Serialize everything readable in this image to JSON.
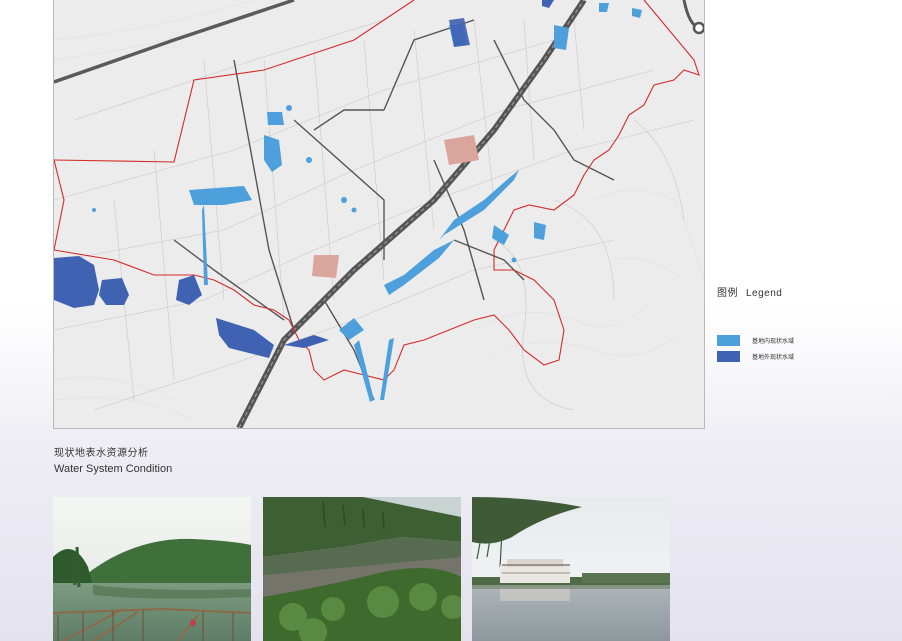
{
  "legend": {
    "title_cn": "图例",
    "title_en": "Legend",
    "items": [
      {
        "label": "基地内现状水域",
        "color": "#4ea0dc"
      },
      {
        "label": "基地外现状水域",
        "color": "#3f62b3"
      }
    ]
  },
  "caption": {
    "cn": "现状地表水资源分析",
    "en": "Water System Condition"
  },
  "colors": {
    "boundary": "#d42a2a",
    "road": "#4d4d4d",
    "water_inside": "#4ea0dc",
    "water_outside": "#3f62b3",
    "settlement": "#d9a59c",
    "map_bg": "#ececec"
  },
  "photos": [
    {
      "name": "lake-with-dock"
    },
    {
      "name": "river-with-reeds"
    },
    {
      "name": "lakeside-building"
    }
  ]
}
